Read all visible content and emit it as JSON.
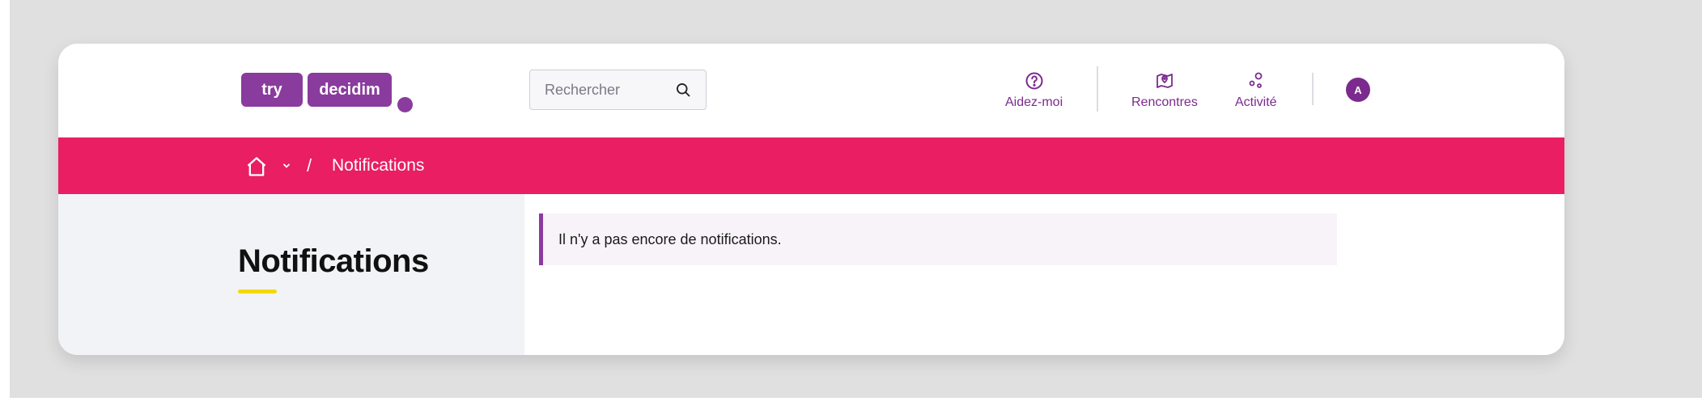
{
  "logo": {
    "part1": "try",
    "part2": "decidim"
  },
  "search": {
    "placeholder": "Rechercher"
  },
  "nav": {
    "help": "Aidez-moi",
    "meetings": "Rencontres",
    "activity": "Activité"
  },
  "user": {
    "avatar_initial": "A"
  },
  "breadcrumb": {
    "separator": "/",
    "current": "Notifications"
  },
  "page": {
    "title": "Notifications",
    "empty_message": "Il n'y a pas encore de notifications."
  },
  "colors": {
    "brand_purple": "#8a3b9e",
    "breadcrumb_bar": "#e91e63",
    "title_accent": "#f4d900"
  }
}
